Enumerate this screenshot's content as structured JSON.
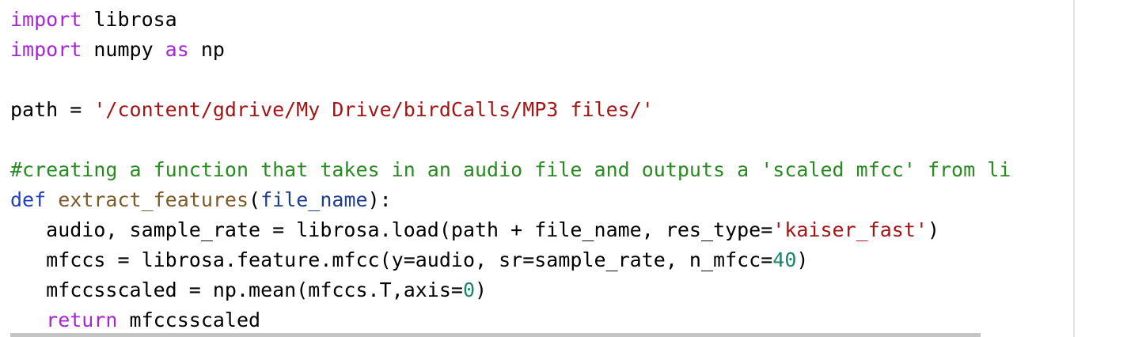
{
  "code": {
    "lines": [
      {
        "tokens": [
          {
            "type": "keyword",
            "text": "import"
          },
          {
            "type": "plain",
            "text": " librosa"
          }
        ]
      },
      {
        "tokens": [
          {
            "type": "keyword",
            "text": "import"
          },
          {
            "type": "plain",
            "text": " numpy "
          },
          {
            "type": "keyword",
            "text": "as"
          },
          {
            "type": "plain",
            "text": " np"
          }
        ]
      },
      {
        "tokens": []
      },
      {
        "tokens": [
          {
            "type": "plain",
            "text": "path = "
          },
          {
            "type": "string",
            "text": "'/content/gdrive/My Drive/birdCalls/MP3 files/'"
          }
        ]
      },
      {
        "tokens": []
      },
      {
        "tokens": [
          {
            "type": "comment",
            "text": "#creating a function that takes in an audio file and outputs a 'scaled mfcc' from li"
          }
        ]
      },
      {
        "tokens": [
          {
            "type": "def",
            "text": "def"
          },
          {
            "type": "plain",
            "text": " "
          },
          {
            "type": "func",
            "text": "extract_features"
          },
          {
            "type": "plain",
            "text": "("
          },
          {
            "type": "param",
            "text": "file_name"
          },
          {
            "type": "plain",
            "text": "):"
          }
        ]
      },
      {
        "tokens": [
          {
            "type": "plain",
            "text": "   audio, sample_rate = librosa.load(path + file_name, res_type="
          },
          {
            "type": "string",
            "text": "'kaiser_fast'"
          },
          {
            "type": "plain",
            "text": ")"
          }
        ]
      },
      {
        "tokens": [
          {
            "type": "plain",
            "text": "   mfccs = librosa.feature.mfcc(y=audio, sr=sample_rate, n_mfcc="
          },
          {
            "type": "number",
            "text": "40"
          },
          {
            "type": "plain",
            "text": ")"
          }
        ]
      },
      {
        "tokens": [
          {
            "type": "plain",
            "text": "   mfccsscaled = np.mean(mfccs.T,axis="
          },
          {
            "type": "number",
            "text": "0"
          },
          {
            "type": "plain",
            "text": ")"
          }
        ]
      },
      {
        "tokens": [
          {
            "type": "plain",
            "text": "   "
          },
          {
            "type": "keyword",
            "text": "return"
          },
          {
            "type": "plain",
            "text": " mfccsscaled"
          }
        ]
      }
    ]
  },
  "colors": {
    "keyword": "#a626d3",
    "def": "#1f3fbf",
    "function_name": "#7b5a28",
    "parameter": "#1c3e8c",
    "string": "#a31515",
    "comment": "#2a8a22",
    "number": "#14866d"
  }
}
